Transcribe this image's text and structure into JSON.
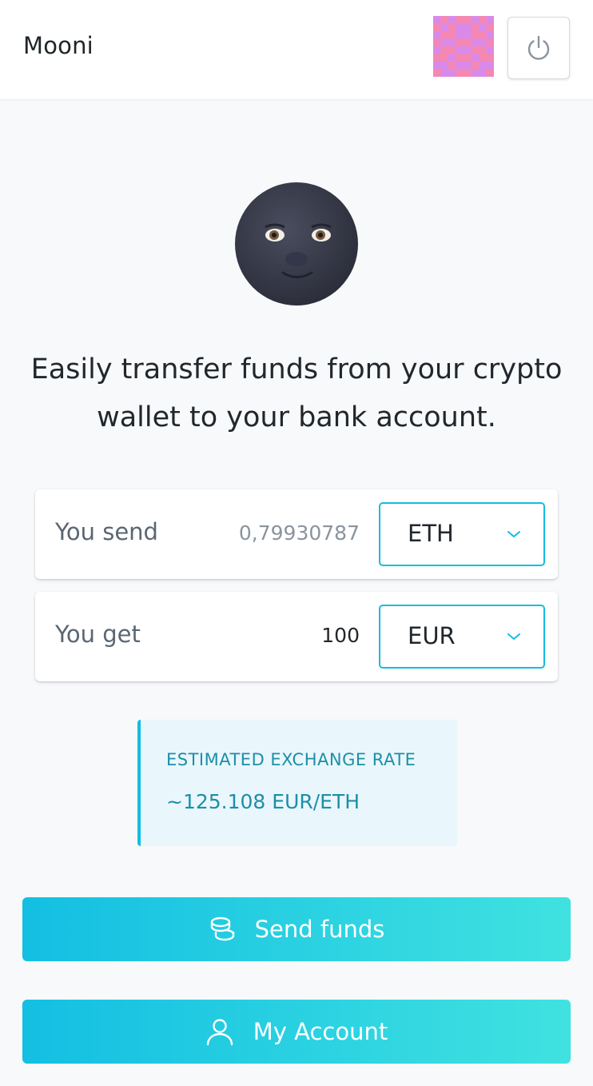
{
  "header": {
    "title": "Mooni",
    "avatar_icon": "identicon-avatar",
    "power_icon": "power-icon"
  },
  "hero": {
    "icon": "new-moon-face-emoji",
    "tagline_line1": "Easily transfer funds from your crypto",
    "tagline_line2": "wallet to your bank account."
  },
  "send": {
    "label": "You send",
    "amount_placeholder": "0,79930787",
    "currency": "ETH"
  },
  "get": {
    "label": "You get",
    "amount": "100",
    "currency": "EUR"
  },
  "rate": {
    "title": "ESTIMATED EXCHANGE RATE",
    "value": "~125.108 EUR/ETH"
  },
  "actions": {
    "send_funds_label": "Send funds",
    "send_funds_icon": "coins-icon",
    "my_account_label": "My Account",
    "my_account_icon": "user-icon"
  },
  "colors": {
    "accent": "#14bde0",
    "accent_end": "#40e2e0",
    "rate_text": "#1e8ea8",
    "rate_bg": "#e9f7fc"
  }
}
